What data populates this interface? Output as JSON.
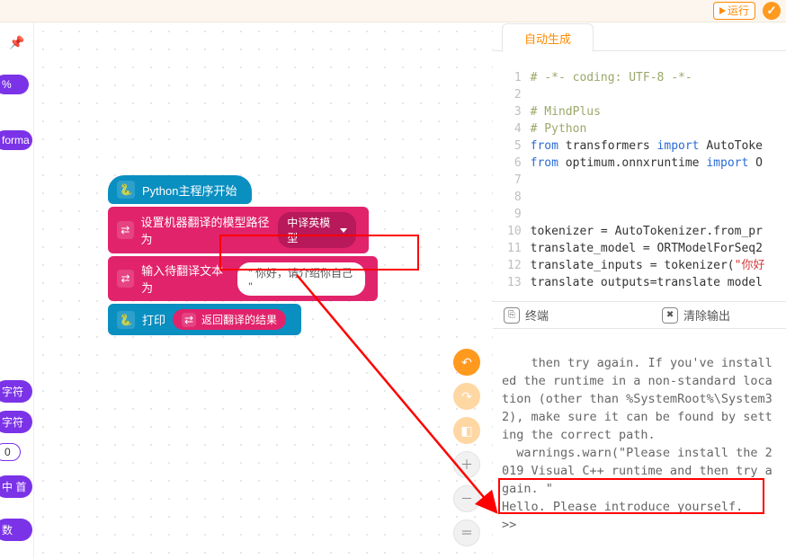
{
  "topbar": {
    "run_label": "运行"
  },
  "left_rail": {
    "pills": [
      "%",
      "forma",
      "字符",
      "字符",
      "中 首",
      "数"
    ],
    "count": "0"
  },
  "blocks": {
    "start": "Python主程序开始",
    "set_model_label": "设置机器翻译的模型路径为",
    "set_model_option": "中译英模型",
    "input_label": "输入待翻译文本为",
    "input_value": "\" 你好，请介绍你自己 \"",
    "print_label": "打印",
    "return_label": "返回翻译的结果"
  },
  "code_tab": "自动生成",
  "code_lines": [
    {
      "n": 1,
      "t": "comment",
      "s": "# -*- coding: UTF-8 -*-"
    },
    {
      "n": 2,
      "t": "",
      "s": ""
    },
    {
      "n": 3,
      "t": "comment",
      "s": "# MindPlus"
    },
    {
      "n": 4,
      "t": "comment",
      "s": "# Python"
    },
    {
      "n": 5,
      "t": "import1",
      "kw1": "from",
      "m": "transformers",
      "kw2": "import",
      "tail": "AutoToke"
    },
    {
      "n": 6,
      "t": "import1",
      "kw1": "from",
      "m": "optimum.onnxruntime",
      "kw2": "import",
      "tail": "O"
    },
    {
      "n": 7,
      "t": "",
      "s": ""
    },
    {
      "n": 8,
      "t": "",
      "s": ""
    },
    {
      "n": 9,
      "t": "",
      "s": ""
    },
    {
      "n": 10,
      "t": "plain",
      "s": "tokenizer = AutoTokenizer.from_pr"
    },
    {
      "n": 11,
      "t": "plain",
      "s": "translate_model = ORTModelForSeq2"
    },
    {
      "n": 12,
      "t": "str",
      "pre": "translate_inputs = tokenizer(",
      "str": "\"你好"
    },
    {
      "n": 13,
      "t": "plain",
      "s": "translate outputs=translate model"
    }
  ],
  "terminal": {
    "title": "终端",
    "clear": "清除输出",
    "body": "then try again. If you've installed the runtime in a non-standard location (other than %SystemRoot%\\System32), make sure it can be found by setting the correct path.\n  warnings.warn(\"Please install the 2019 Visual C++ runtime and then try again. \"\nHello. Please introduce yourself.\n>> "
  }
}
